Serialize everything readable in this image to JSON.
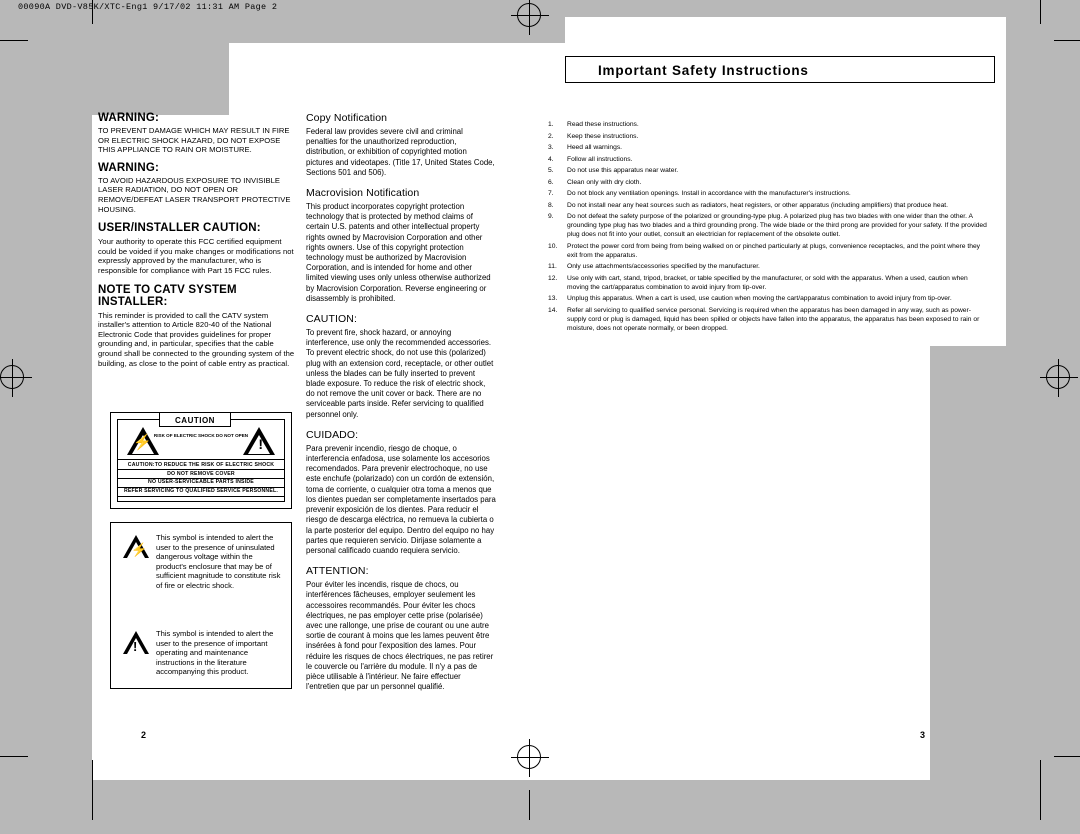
{
  "slug": "00090A DVD-V85K/XTC-Eng1  9/17/02 11:31 AM  Page 2",
  "right_page": {
    "title": "Important Safety Instructions",
    "folio": "3",
    "instructions": [
      {
        "num": "1.",
        "text": "Read these instructions."
      },
      {
        "num": "2.",
        "text": "Keep these instructions."
      },
      {
        "num": "3.",
        "text": "Heed all warnings."
      },
      {
        "num": "4.",
        "text": "Follow all instructions."
      },
      {
        "num": "5.",
        "text": "Do not use this apparatus near water."
      },
      {
        "num": "6.",
        "text": "Clean only with dry cloth."
      },
      {
        "num": "7.",
        "text": "Do not block any ventilation openings. Install in accordance with the manufacturer's instructions."
      },
      {
        "num": "8.",
        "text": "Do not install near any heat sources such as radiators, heat registers, or other apparatus (including amplifiers) that produce heat."
      },
      {
        "num": "9.",
        "text": "Do not defeat the safety purpose of the polarized or grounding-type plug. A polarized plug has two blades with one wider than the other. A grounding type plug has two blades and a third grounding prong. The wide blade or the third prong are provided for your safety. If the provided plug does not fit into your outlet, consult an electrician for replacement of the obsolete outlet."
      },
      {
        "num": "10.",
        "text": "Protect the power cord from being from being walked on or pinched particularly at plugs, convenience receptacles, and the point where they exit from the apparatus."
      },
      {
        "num": "11.",
        "text": "Only use attachments/accessories specified by the manufacturer."
      },
      {
        "num": "12.",
        "text": "Use only with cart, stand, tripod, bracket, or table specified by the manufacturer, or sold with the apparatus. When a used, caution when moving the cart/apparatus combination to avoid injury from tip-over."
      },
      {
        "num": "13.",
        "text": "Unplug this apparatus. When a cart is used, use caution when moving the cart/apparatus combination to avoid injury from tip-over."
      },
      {
        "num": "14.",
        "text": "Refer all servicing to qualified service personal. Servicing is required when the apparatus has been damaged in any way, such as power-supply cord or plug is damaged, liquid has been spilled or objects have fallen into the apparatus, the apparatus has been exposed to rain or moisture, does not operate normally, or been dropped."
      }
    ]
  },
  "left_page": {
    "folio": "2",
    "column1": {
      "warning1_head": "WARNING:",
      "warning1_body": "TO PREVENT DAMAGE WHICH MAY RESULT IN FIRE OR ELECTRIC SHOCK HAZARD, DO NOT EXPOSE THIS APPLIANCE TO RAIN OR MOISTURE.",
      "warning2_head": "WARNING:",
      "warning2_body": "TO AVOID HAZARDOUS EXPOSURE TO INVISIBLE LASER RADIATION, DO NOT OPEN OR REMOVE/DEFEAT LASER TRANSPORT PROTECTIVE HOUSING.",
      "user_head": "USER/INSTALLER CAUTION:",
      "user_body": "Your authority to operate this FCC certified equipment could be voided if you make changes or modifications not expressly approved by the manufacturer, who is responsible for compliance with Part 15 FCC rules.",
      "catv_head": "NOTE TO CATV SYSTEM INSTALLER:",
      "catv_body": "This reminder is provided to call the CATV system installer's attention to Article 820-40 of the National Electronic Code that provides guidelines for proper grounding and, in particular, specifies that the cable ground shall be connected to the grounding system of the building, as close to the point of cable entry as practical."
    },
    "column2": {
      "copy_head": "Copy Notification",
      "copy_body": "Federal law provides severe civil and criminal penalties for the unauthorized reproduction, distribution, or exhibition of copyrighted motion pictures and videotapes. (Title 17, United States Code, Sections 501 and 506).",
      "macro_head": "Macrovision Notification",
      "macro_body": "This product incorporates copyright protection technology that is protected by method claims of certain U.S. patents and other intellectual property rights owned by Macrovision Corporation and other rights owners. Use of this copyright protection technology must be authorized by Macrovision Corporation, and is intended for home and other limited viewing uses only unless otherwise authorized by Macrovision Corporation. Reverse engineering or disassembly is prohibited.",
      "caution_head": "CAUTION:",
      "caution_body": "To prevent fire, shock hazard, or annoying interference, use only the recommended accessories. To prevent electric shock, do not use this (polarized) plug with an extension cord, receptacle, or other outlet unless the blades can be fully inserted to prevent blade exposure. To reduce the risk of electric shock, do not remove the unit cover or back. There are no serviceable parts inside. Refer servicing to qualified personnel only.",
      "cuidado_head": "CUIDADO:",
      "cuidado_body": "Para prevenir incendio, riesgo de choque, o interferencia enfadosa, use solamente los accesorios recomendados. Para prevenir electrochoque, no use este enchufe (polarizado) con un cordón de extensión, toma de corriente, o cualquier otra toma a menos que los dientes puedan ser completamente insertados para prevenir exposición de los dientes. Para reducir el riesgo de descarga eléctrica, no remueva la cubierta o la parte posterior del equipo. Dentro del equipo no hay partes que requieren servicio. Dirijase solamente a personal calificado cuando requiera servicio.",
      "attention_head": "ATTENTION:",
      "attention_body": "Pour éviter les incendis, risque de chocs, ou interférences fâcheuses, employer seulement les accessoires recommandés. Pour éviter les chocs électriques, ne pas employer cette prise (polarisée) avec une rallonge, une prise de courant ou une autre sortie de courant à moins que les lames peuvent être insérées à fond pour l'exposition des lames. Pour réduire les risques de chocs électriques, ne pas retirer le couvercle ou l'arrière du module. Il n'y a pas de pièce utilisable à l'intérieur. Ne faire effectuer l'entretien que par un personnel qualifié."
    },
    "caution_label": {
      "box_word": "CAUTION",
      "left_tri_caption": "RISK OF ELECTRIC SHOCK DO NOT OPEN",
      "line1": "CAUTION:TO REDUCE THE RISK OF ELECTRIC SHOCK",
      "line2": "DO NOT REMOVE COVER",
      "line3": "NO USER-SERVICEABLE PARTS INSIDE",
      "line4": "REFER SERVICING TO QUALIFIED SERVICE PERSONNEL."
    },
    "symbol_box": {
      "item1": "This symbol is intended to alert the user to the presence of uninsulated dangerous voltage within the product's enclosure that may be of sufficient magnitude to constitute risk of fire or electric shock.",
      "item2": "This symbol is intended to alert the user to the presence of important operating and maintenance instructions in the literature accompanying this product."
    }
  }
}
